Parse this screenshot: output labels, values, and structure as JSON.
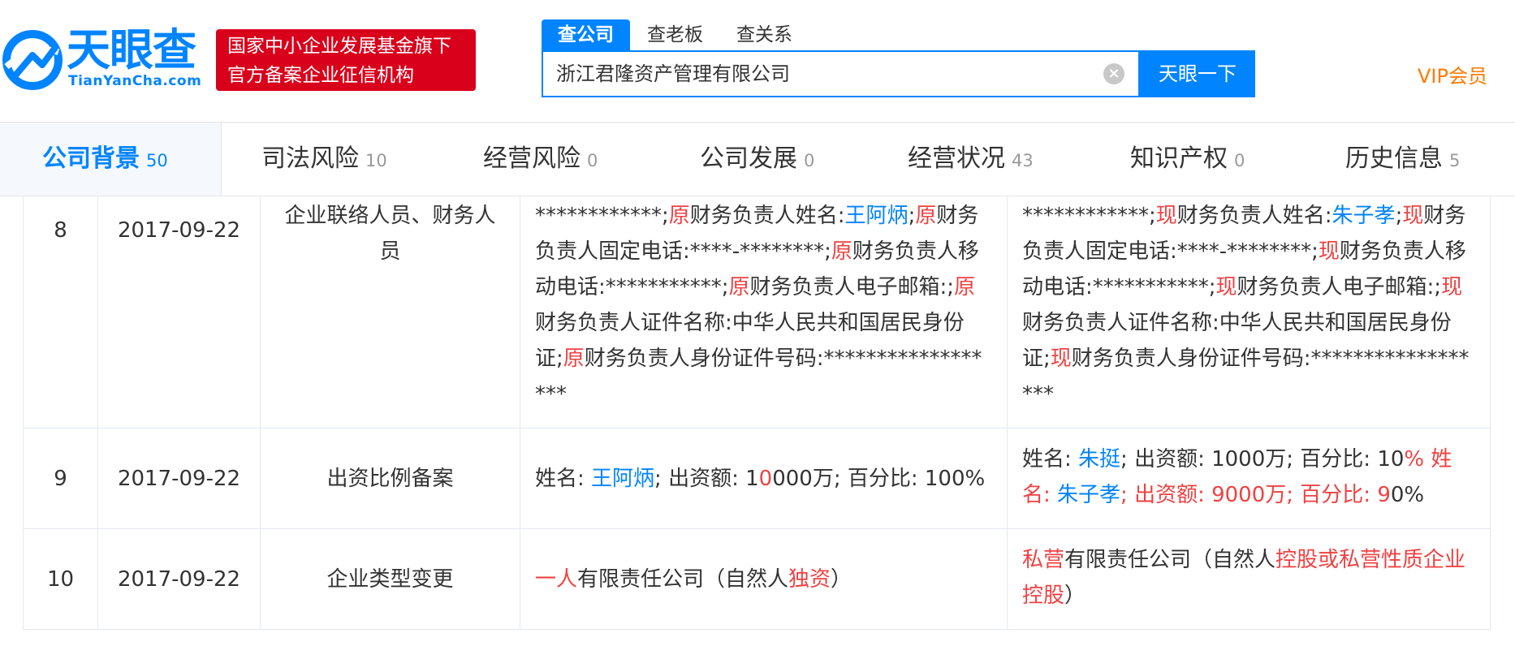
{
  "header": {
    "logo_text": "天眼查",
    "logo_sub": "TianYanCha.com",
    "badge_line1": "国家中小企业发展基金旗下",
    "badge_line2": "官方备案企业征信机构",
    "search_tabs": [
      "查公司",
      "查老板",
      "查关系"
    ],
    "search_value": "浙江君隆资产管理有限公司",
    "search_button": "天眼一下",
    "vip_label": "VIP会员"
  },
  "nav": {
    "items": [
      {
        "label": "公司背景",
        "count": "50"
      },
      {
        "label": "司法风险",
        "count": "10"
      },
      {
        "label": "经营风险",
        "count": "0"
      },
      {
        "label": "公司发展",
        "count": "0"
      },
      {
        "label": "经营状况",
        "count": "43"
      },
      {
        "label": "知识产权",
        "count": "0"
      },
      {
        "label": "历史信息",
        "count": "5"
      }
    ]
  },
  "table": {
    "rows": [
      {
        "index": "8",
        "date": "2017-09-22",
        "item": "企业联络人员、财务人员",
        "before": [
          {
            "t": "************;"
          },
          {
            "t": "原",
            "c": "red"
          },
          {
            "t": "财务负责人姓名:"
          },
          {
            "t": "王阿炳",
            "c": "blue"
          },
          {
            "t": ";"
          },
          {
            "t": "原",
            "c": "red"
          },
          {
            "t": "财务负责人固定电话:****-********;"
          },
          {
            "t": "原",
            "c": "red"
          },
          {
            "t": "财务负责人移动电话:***********;"
          },
          {
            "t": "原",
            "c": "red"
          },
          {
            "t": "财务负责人电子邮箱:;"
          },
          {
            "t": "原",
            "c": "red"
          },
          {
            "t": "财务负责人证件名称:中华人民共和国居民身份证;"
          },
          {
            "t": "原",
            "c": "red"
          },
          {
            "t": "财务负责人身份证件号码:******************"
          }
        ],
        "after": [
          {
            "t": "************;"
          },
          {
            "t": "现",
            "c": "red"
          },
          {
            "t": "财务负责人姓名:"
          },
          {
            "t": "朱子孝",
            "c": "blue"
          },
          {
            "t": ";"
          },
          {
            "t": "现",
            "c": "red"
          },
          {
            "t": "财务负责人固定电话:****-********;"
          },
          {
            "t": "现",
            "c": "red"
          },
          {
            "t": "财务负责人移动电话:***********;"
          },
          {
            "t": "现",
            "c": "red"
          },
          {
            "t": "财务负责人电子邮箱:;"
          },
          {
            "t": "现",
            "c": "red"
          },
          {
            "t": "财务负责人证件名称:中华人民共和国居民身份证;"
          },
          {
            "t": "现",
            "c": "red"
          },
          {
            "t": "财务负责人身份证件号码:******************"
          }
        ]
      },
      {
        "index": "9",
        "date": "2017-09-22",
        "item": "出资比例备案",
        "before": [
          {
            "t": "姓名: "
          },
          {
            "t": "王阿炳",
            "c": "blue"
          },
          {
            "t": "; 出资额: 1"
          },
          {
            "t": "0",
            "c": "red"
          },
          {
            "t": "000万; 百分比: 100%"
          }
        ],
        "after": [
          {
            "t": "姓名: "
          },
          {
            "t": "朱挺",
            "c": "blue"
          },
          {
            "t": "; 出资额: 1000万; 百分比: 10"
          },
          {
            "t": "% 姓名: ",
            "c": "red"
          },
          {
            "t": "朱子孝",
            "c": "blue"
          },
          {
            "t": "; 出资额: 9000万; 百分比: 9",
            "c": "red"
          },
          {
            "t": "0%"
          }
        ]
      },
      {
        "index": "10",
        "date": "2017-09-22",
        "item": "企业类型变更",
        "before": [
          {
            "t": "一人",
            "c": "red"
          },
          {
            "t": "有限责任公司（自然人"
          },
          {
            "t": "独资",
            "c": "red"
          },
          {
            "t": "）"
          }
        ],
        "after": [
          {
            "t": "私营",
            "c": "red"
          },
          {
            "t": "有限责任公司（自然人"
          },
          {
            "t": "控股或私营性质企业控股",
            "c": "red"
          },
          {
            "t": "）"
          }
        ]
      }
    ]
  },
  "colors": {
    "accent": "#0084ff",
    "red": "#f04142",
    "badge": "#d9001b",
    "vip": "#ff7a00"
  }
}
